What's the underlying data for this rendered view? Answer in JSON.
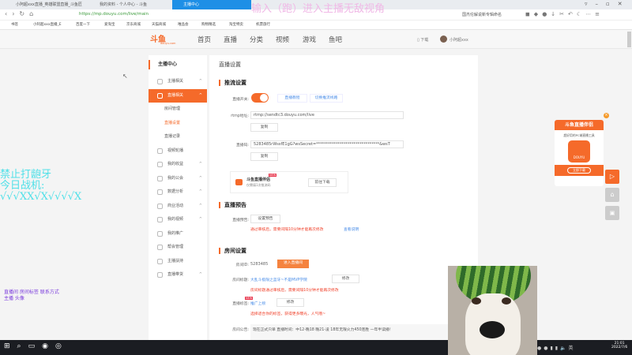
{
  "browser": {
    "tabs": [
      {
        "label": "小阿超xxx直播_英雄联盟直播_斗鱼匠"
      },
      {
        "label": "我的资料 - 个人中心 - 斗鱼"
      },
      {
        "label": "主播中心"
      }
    ],
    "url": "https://mp.douyu.com/live/main",
    "search_hint": "国杰伦解说新专辑命名",
    "bookmarks": [
      "书签",
      "小阿超xxx直播_E",
      "百度一下",
      "爱淘宝",
      "京东商城",
      "天猫商城",
      "唯品会",
      "购物精选",
      "淘宝特卖",
      "机票旅行"
    ]
  },
  "site": {
    "logo": "斗鱼",
    "logo_sub": "douyu.com",
    "nav": [
      "首页",
      "直播",
      "分类",
      "视频",
      "游戏",
      "鱼吧"
    ],
    "download": "下载",
    "username": "小阿超xxx"
  },
  "sidebar": {
    "title": "主播中心",
    "items": [
      {
        "label": "主播相关",
        "chevron": "^"
      },
      {
        "label": "直播相关",
        "chevron": "^",
        "active": true
      },
      {
        "label": "房间管理",
        "sub": true
      },
      {
        "label": "直播设置",
        "sub": true,
        "current": true
      },
      {
        "label": "直播记录",
        "sub": true
      },
      {
        "label": "视频轮播"
      },
      {
        "label": "我的收益",
        "chevron": "^"
      },
      {
        "label": "我的公会",
        "chevron": "^"
      },
      {
        "label": "数据分析",
        "chevron": "^"
      },
      {
        "label": "商业活动",
        "chevron": "^"
      },
      {
        "label": "我的视频",
        "chevron": "^"
      },
      {
        "label": "我的推广"
      },
      {
        "label": "帮会管理"
      },
      {
        "label": "主播扶持"
      },
      {
        "label": "直播带货",
        "chevron": "^"
      }
    ]
  },
  "main": {
    "title": "直播设置",
    "push": {
      "heading": "推流设置",
      "switch_label": "直播开关:",
      "switch_on": true,
      "link1": "直播教程",
      "link2": "切换推流线路",
      "rtmp_label": "rtmp地址:",
      "rtmp_value": "rtmp://sendtc3.douyu.com/live",
      "copy": "复制",
      "code_label": "直播码:",
      "code_value": "5283485rWssfE1gG?wsSecret=********************************&wsT",
      "promo_title": "斗鱼直播伴侣",
      "promo_badge": "NEW",
      "promo_sub": "仅需填1次推流码",
      "promo_btn": "前往下载"
    },
    "preview": {
      "heading": "直播预告",
      "label": "直播预告:",
      "btn": "设置预告",
      "note": "通过审核后，需要间隔10分钟才能再次修改",
      "link": "查看说明"
    },
    "room": {
      "heading": "房间设置",
      "id_label": "房间ID:",
      "id_value": "5283485",
      "enter_btn": "进入直播间",
      "title_label": "房间标题:",
      "title_value": "大乱斗极限之蓝牙~不是MVP学院",
      "edit": "修改",
      "title_note": "房间标题通过审核后，需要间隔10分钟才能再次修改",
      "tag_label": "直播标签:",
      "tag_badge": "NEW",
      "tag_value": "推广上榜",
      "tag_note": "选择适合你的标签，获得更多曝光，人气哦~",
      "notice_label": "房间公告:",
      "notice_value": "现在正式只单 直播时间：中12-晚18 晚21-凌 18年无限火力450连胜 一年半读播！"
    }
  },
  "float_ad": {
    "title": "斗鱼直播伴侣",
    "sub": "超好用的PC端直播工具",
    "app": "DOUYU",
    "btn": "立即下载"
  },
  "overlays": {
    "top": "输入（跑）进入主播无敌视角",
    "left": "禁止打龅牙\n今日战机:\n√√√XX√X√√√√X",
    "small": "直播间 房间标签 联系方式\n主播 头像"
  },
  "taskbar": {
    "time": "21:01",
    "date": "2022/7/6"
  },
  "colors": {
    "accent": "#f56a2a",
    "tab_active": "#1e8fe6"
  }
}
